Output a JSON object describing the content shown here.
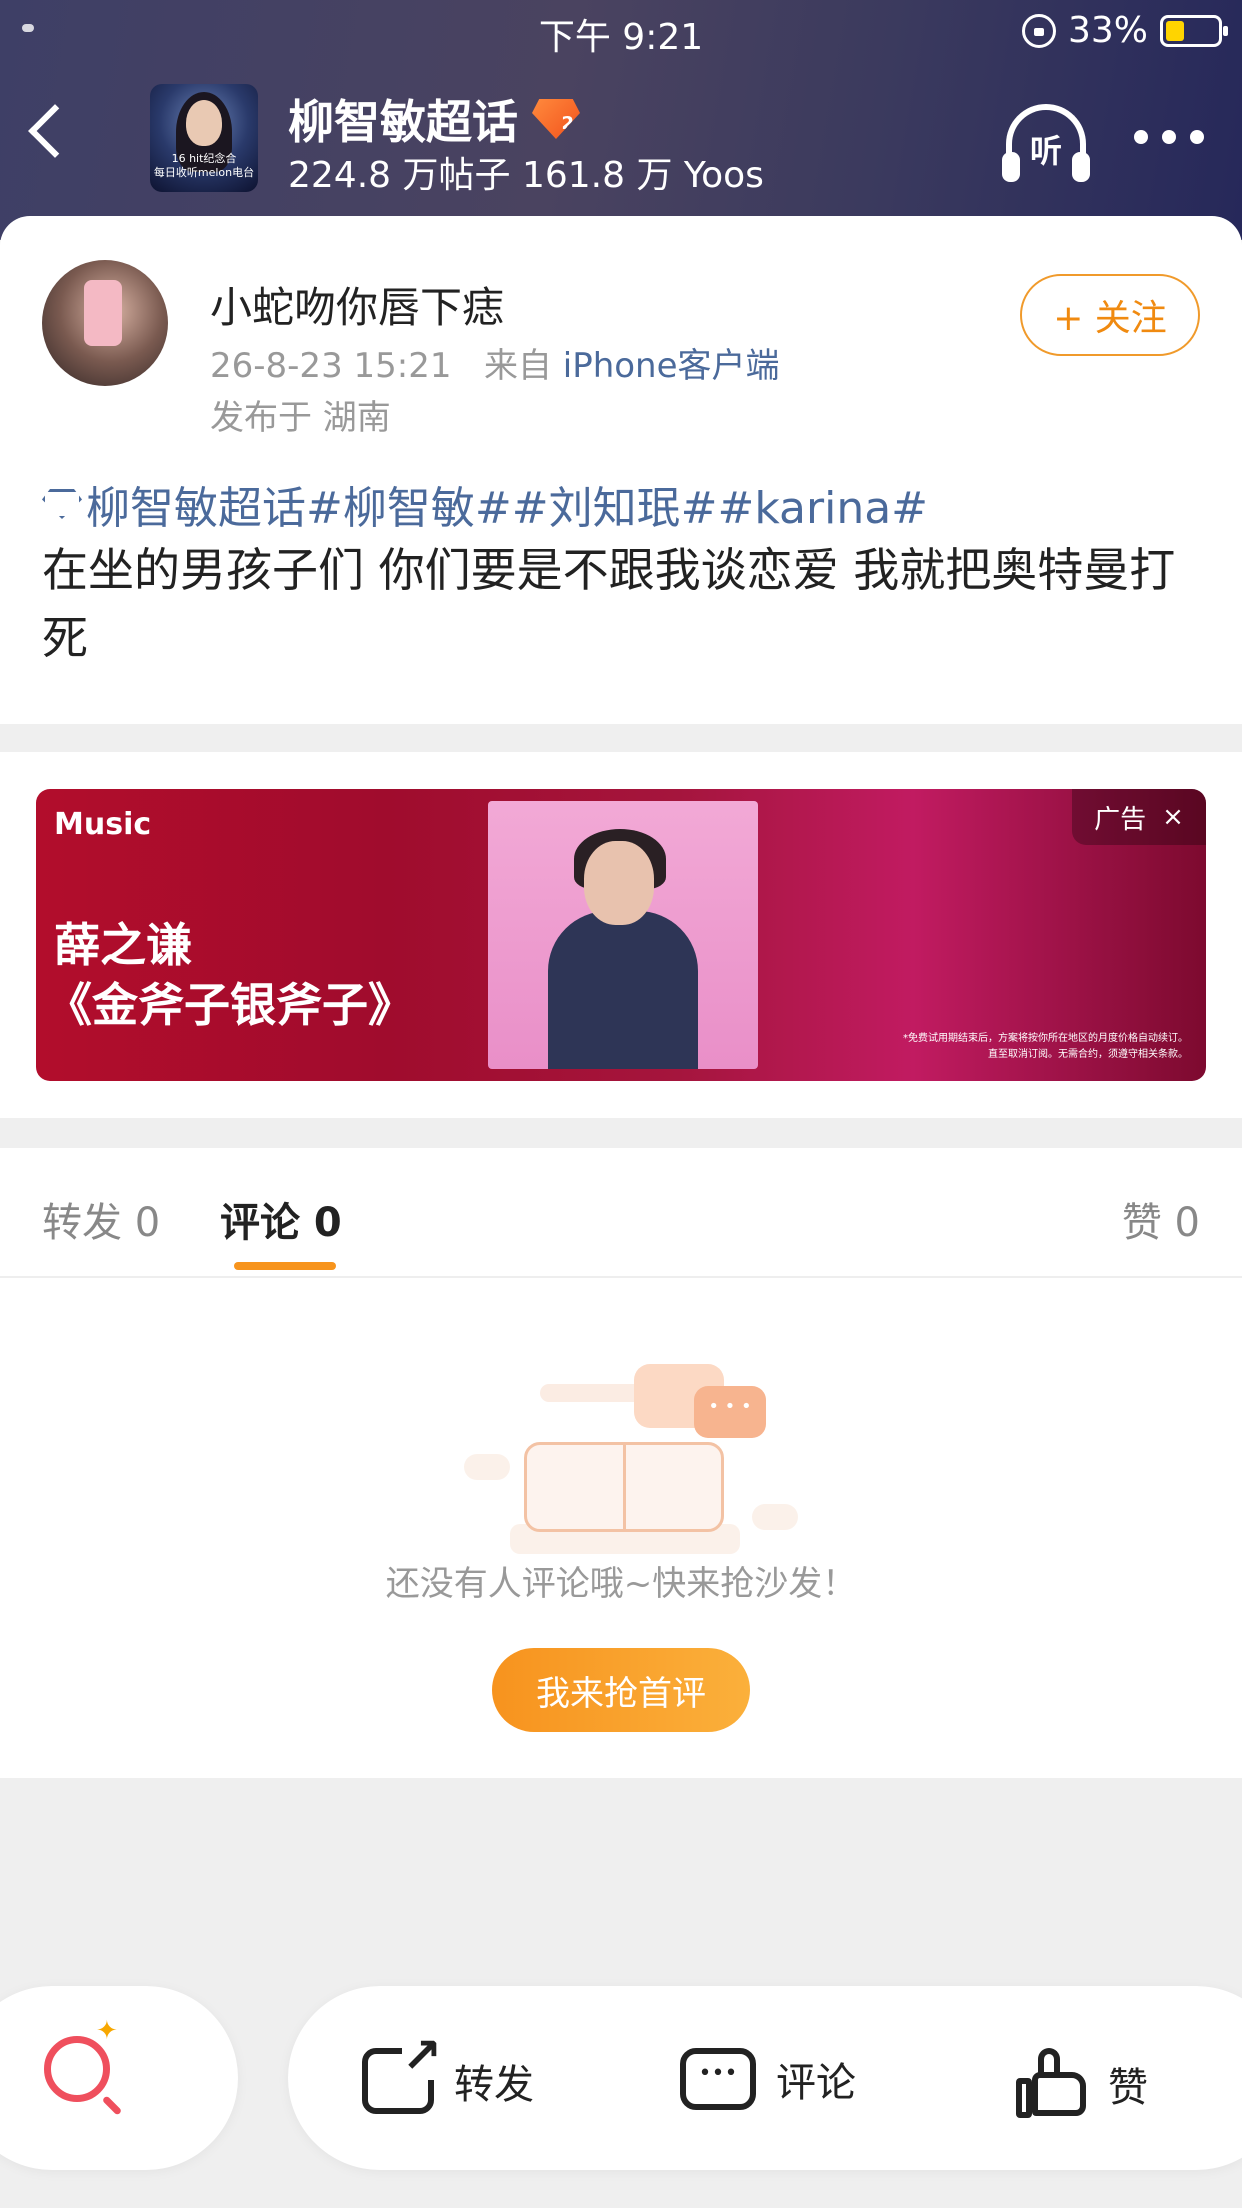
{
  "status_bar": {
    "time": "下午 9:21",
    "battery": "33%"
  },
  "header": {
    "topic_title": "柳智敏超话",
    "level": "2",
    "stats": "224.8 万帖子 161.8 万 Yoos",
    "avatar_caption": "16 hit纪念合\n每日收听melon电台",
    "listen_label": "听"
  },
  "post": {
    "user_name": "小蛇吻你唇下痣",
    "date": "26-8-23 15:21",
    "from_prefix": "来自",
    "source": "iPhone客户端",
    "location": "发布于  湖南",
    "follow_label": "+ 关注",
    "tags": "柳智敏超话#柳智敏##刘知珉##karina#",
    "text": "在坐的男孩子们 你们要是不跟我谈恋爱 我就把奥特曼打死"
  },
  "ad": {
    "brand": "Music",
    "artist": "薛之谦",
    "song": "《金斧子银斧子》",
    "label": "广告",
    "close": "×",
    "fine_print": "*免费试用期结束后，方案将按你所在地区的月度价格自动续订。\n直至取消订阅。无需合约，须遵守相关条款。"
  },
  "tabs": {
    "repost": "转发 0",
    "comment": "评论 0",
    "like": "赞 0"
  },
  "empty": {
    "message": "还没有人评论哦~快来抢沙发！",
    "button": "我来抢首评"
  },
  "bottom_bar": {
    "repost": "转发",
    "comment": "评论",
    "like": "赞"
  },
  "icons": [
    "back-icon",
    "headphones-icon",
    "more-icon",
    "diamond-icon",
    "search-icon",
    "share-icon",
    "comment-icon",
    "like-icon"
  ],
  "colors": {
    "accent": "#f7941d",
    "link": "#4b6a9b",
    "header": "#3e3f66"
  }
}
